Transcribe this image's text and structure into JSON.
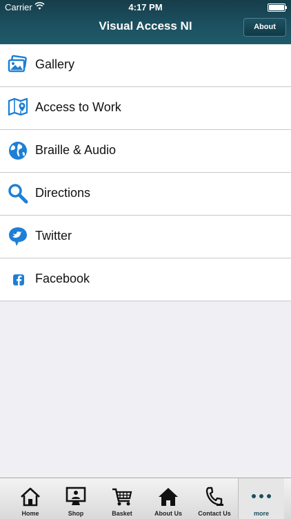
{
  "status": {
    "carrier": "Carrier",
    "time": "4:17 PM"
  },
  "header": {
    "title": "Visual Access NI",
    "about_label": "About"
  },
  "menu": [
    {
      "label": "Gallery",
      "icon": "gallery-icon"
    },
    {
      "label": "Access to Work",
      "icon": "map-pin-icon"
    },
    {
      "label": "Braille & Audio",
      "icon": "globe-icon"
    },
    {
      "label": "Directions",
      "icon": "search-icon"
    },
    {
      "label": "Twitter",
      "icon": "twitter-bird-icon"
    },
    {
      "label": "Facebook",
      "icon": "facebook-icon"
    }
  ],
  "tabs": [
    {
      "label": "Home",
      "icon": "home-icon"
    },
    {
      "label": "Shop",
      "icon": "shop-icon"
    },
    {
      "label": "Basket",
      "icon": "basket-icon"
    },
    {
      "label": "About Us",
      "icon": "house-icon"
    },
    {
      "label": "Contact Us",
      "icon": "phone-icon"
    },
    {
      "label": "more",
      "icon": "more-dots-icon",
      "active": true
    }
  ],
  "colors": {
    "accent": "#1e7fd6",
    "header": "#1c5060",
    "active_tab": "#1a4f5f"
  }
}
